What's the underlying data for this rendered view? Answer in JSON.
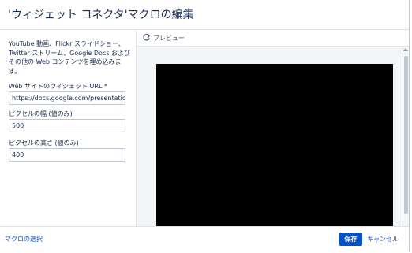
{
  "dialog": {
    "title": "'ウィジェット コネクタ'マクロの編集"
  },
  "form": {
    "description": "YouTube 動画、Flickr スライドショー、Twitter ストリーム、Google Docs およびその他の Web コンテンツを埋め込みます。",
    "url_label": "Web サイトのウィジェット URL *",
    "url_value": "https://docs.google.com/presentation/",
    "width_label": "ピクセルの幅 (値のみ)",
    "width_value": "500",
    "height_label": "ピクセルの高さ (値のみ)",
    "height_value": "400"
  },
  "preview": {
    "label": "プレビュー",
    "icon": "refresh-icon"
  },
  "footer": {
    "select_macro": "マクロの選択",
    "save": "保存",
    "cancel": "キャンセル"
  },
  "colors": {
    "primary": "#0052cc",
    "text": "#172b4d",
    "border": "#dfe1e6",
    "preview_bg": "#000000"
  }
}
